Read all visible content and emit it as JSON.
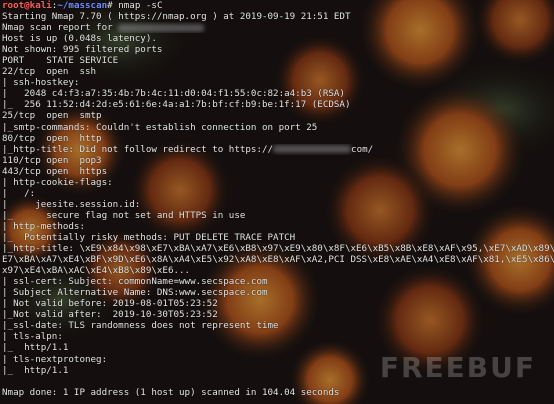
{
  "prompt": {
    "user": "root@kali",
    "path": "~/masscan",
    "symbol": "#",
    "command": " nmap -sC"
  },
  "lines": {
    "l2": "Starting Nmap 7.70 ( https://nmap.org ) at 2019-09-19 21:51 EDT",
    "l3a": "Nmap scan report for",
    "l4": "Host is up (0.048s latency).",
    "l5": "Not shown: 995 filtered ports",
    "l6": "PORT    STATE SERVICE",
    "l7": "22/tcp  open  ssh",
    "l8": "| ssh-hostkey:",
    "l9": "|   2048 c4:f3:a7:35:4b:7b:4c:11:d0:04:f1:55:0c:82:a4:b3 (RSA)",
    "l10": "|_  256 11:52:d4:2d:e5:61:6e:4a:a1:7b:bf:cf:b9:be:1f:17 (ECDSA)",
    "l11": "25/tcp  open  smtp",
    "l12": "|_smtp-commands: Couldn't establish connection on port 25",
    "l13": "80/tcp  open  http",
    "l14a": "|_http-title: Did not follow redirect to https://",
    "l14b": "com/",
    "l15": "110/tcp open  pop3",
    "l16": "443/tcp open  https",
    "l17": "| http-cookie-flags:",
    "l18": "|   /:",
    "l19": "|     jeesite.session.id:",
    "l20": "|_      secure flag not set and HTTPS in use",
    "l21": "| http-methods:",
    "l22": "|_  Potentially risky methods: PUT DELETE TRACE PATCH",
    "l23": "|_http-title: \\xE9\\x84\\x98\\xE7\\xBA\\xA7\\xE6\\xB8\\x97\\xE9\\x80\\x8F\\xE6\\xB5\\x8B\\xE8\\xAF\\x95,\\xE7\\xAD\\x89\\x",
    "l24": "E7\\xBA\\xA7\\xE4\\xBF\\x9D\\xE6\\x8A\\xA4\\xE5\\x92\\xA8\\xE8\\xAF\\xA2,PCI DSS\\xE8\\xAE\\xA4\\xE8\\xAF\\x81,\\xE5\\x86\\",
    "l25": "x97\\xE4\\xBA\\xAC\\xE4\\xB8\\x89\\xE6...",
    "l26": "| ssl-cert: Subject: commonName=www.secspace.com",
    "l27": "| Subject Alternative Name: DNS:www.secspace.com",
    "l28": "| Not valid before: 2019-08-01T05:23:52",
    "l29": "|_Not valid after:  2019-10-30T05:23:52",
    "l30": "|_ssl-date: TLS randomness does not represent time",
    "l31": "| tls-alpn:",
    "l32": "|_  http/1.1",
    "l33": "| tls-nextprotoneg:",
    "l34": "|_  http/1.1",
    "l35": "",
    "l36": "Nmap done: 1 IP address (1 host up) scanned in 104.04 seconds"
  },
  "watermark": "FREEBUF",
  "colors": {
    "user": "#ff5b5b",
    "path": "#6f8dff",
    "text": "#e4e4e4",
    "background": "#1c1614"
  }
}
